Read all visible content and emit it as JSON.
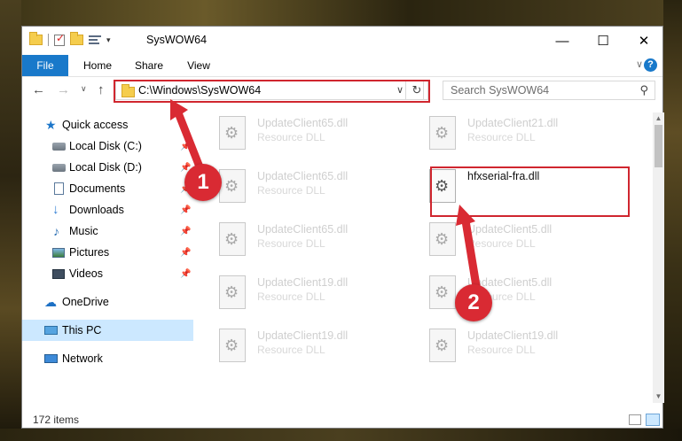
{
  "window": {
    "title": "SysWOW64",
    "minimize_glyph": "—",
    "maximize_glyph": "☐",
    "close_glyph": "✕"
  },
  "quick_access_toolbar": {
    "customize_glyph": "▾"
  },
  "ribbon": {
    "tabs": [
      {
        "label": "File",
        "active": true
      },
      {
        "label": "Home"
      },
      {
        "label": "Share"
      },
      {
        "label": "View"
      }
    ],
    "collapse_glyph": "∨",
    "help_glyph": "?"
  },
  "navigation": {
    "back_glyph": "←",
    "forward_glyph": "→",
    "recent_glyph": "∨",
    "up_glyph": "↑",
    "address": "C:\\Windows\\SysWOW64",
    "address_dropdown_glyph": "∨",
    "refresh_glyph": "↻",
    "search_placeholder": "Search SysWOW64",
    "search_glyph": "⚲"
  },
  "sidebar": {
    "pin_glyph": "📌",
    "items": [
      {
        "label": "Quick access",
        "icon": "star-icon"
      },
      {
        "label": "Local Disk (C:)",
        "icon": "disk-icon",
        "pinned": true
      },
      {
        "label": "Local Disk (D:)",
        "icon": "disk-icon",
        "pinned": true
      },
      {
        "label": "Documents",
        "icon": "documents-icon",
        "pinned": true
      },
      {
        "label": "Downloads",
        "icon": "download-icon",
        "pinned": true
      },
      {
        "label": "Music",
        "icon": "music-icon",
        "pinned": true
      },
      {
        "label": "Pictures",
        "icon": "pictures-icon",
        "pinned": true
      },
      {
        "label": "Videos",
        "icon": "videos-icon",
        "pinned": true
      },
      {
        "label": "OneDrive",
        "icon": "cloud-icon"
      },
      {
        "label": "This PC",
        "icon": "computer-icon",
        "selected": true
      },
      {
        "label": "Network",
        "icon": "network-icon"
      }
    ]
  },
  "files": [
    {
      "name": "UpdateClient65.dll",
      "type": "Resource DLL"
    },
    {
      "name": "UpdateClient21.dll",
      "type": "Resource DLL"
    },
    {
      "name": "UpdateClient65.dll",
      "type": "Resource DLL"
    },
    {
      "name": "hfxserial-fra.dll",
      "type": "",
      "highlighted": true
    },
    {
      "name": "UpdateClient65.dll",
      "type": "Resource DLL"
    },
    {
      "name": "UpdateClient5.dll",
      "type": "Resource DLL"
    },
    {
      "name": "UpdateClient19.dll",
      "type": "Resource DLL"
    },
    {
      "name": "UpdateClient5.dll",
      "type": "Resource DLL"
    },
    {
      "name": "UpdateClient19.dll",
      "type": "Resource DLL"
    },
    {
      "name": "UpdateClient19.dll",
      "type": "Resource DLL"
    }
  ],
  "status": {
    "item_count": "172 items"
  },
  "scrollbar": {
    "up_glyph": "▲",
    "down_glyph": "▼"
  },
  "callouts": [
    {
      "number": "1"
    },
    {
      "number": "2"
    }
  ],
  "colors": {
    "accent": "#1979ca",
    "highlight": "#d0262f",
    "selection": "#cce8ff"
  }
}
